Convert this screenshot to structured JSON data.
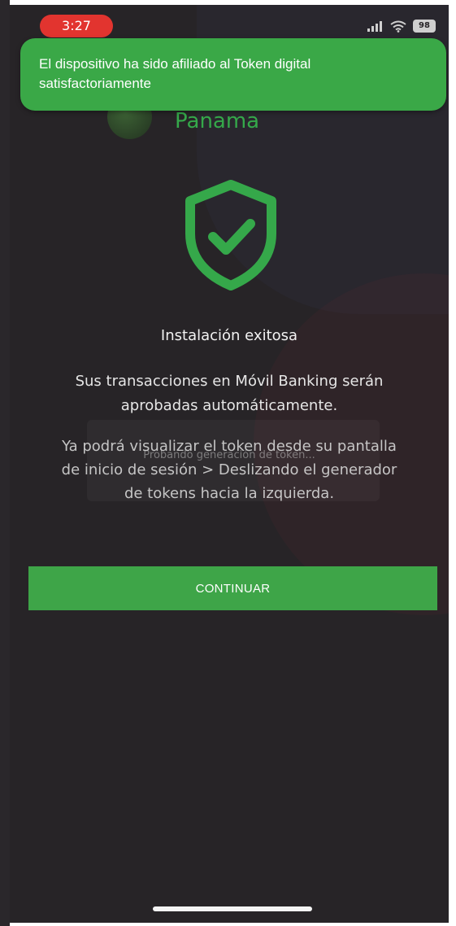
{
  "status_bar": {
    "time": "3:27",
    "battery": "98"
  },
  "brand": {
    "name": "Panama"
  },
  "toast": {
    "message": "El dispositivo ha sido afiliado al Token digital satisfactoriamente"
  },
  "content": {
    "title": "Instalación exitosa",
    "description": "Sus transacciones en Móvil Banking serán aprobadas automáticamente.",
    "info": "Ya podrá visualizar el token desde su pantalla de inicio de sesión > Deslizando el generador de tokens hacia la izquierda.",
    "ghost_text": "Probando generación de token..."
  },
  "actions": {
    "continue_label": "CONTINUAR"
  },
  "colors": {
    "accent_green": "#3ea548",
    "background": "#272427",
    "time_pill": "#e2342f"
  }
}
